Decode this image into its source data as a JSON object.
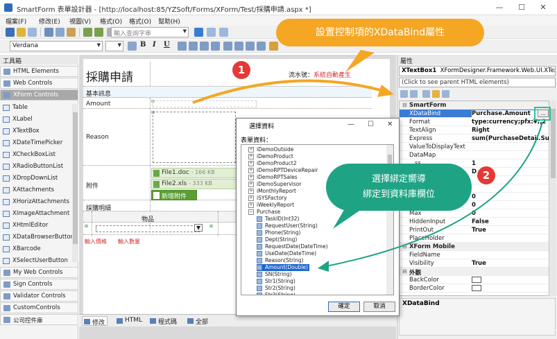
{
  "window": {
    "title": "SmartForm 表單設計器 - [http://localhost:85/YZSoft/Forms/XForm/Test/採購申請.aspx *]",
    "minimize": "—",
    "maximize": "☐",
    "close": "✕"
  },
  "menu": [
    "檔案(F)",
    "修改(E)",
    "視圖(V)",
    "格式(O)",
    "格式(O)",
    "幫助(H)"
  ],
  "toolbar": {
    "search_placeholder": "輸入查詢字串",
    "font_name": "Verdana",
    "bold": "B",
    "italic": "I",
    "underline": "U"
  },
  "toolbox": {
    "header": "工具箱",
    "groups_top": [
      "HTML Elements",
      "Web Controls",
      "XForm Controls"
    ],
    "items": [
      "Table",
      "XLabel",
      "XTextBox",
      "XDateTimePicker",
      "XCheckBoxList",
      "XRadioButtonList",
      "XDropDownList",
      "XAttachments",
      "XHorizAttachments",
      "XImageAttachment",
      "XHtmlEditor",
      "XDataBrowserButton",
      "XBarcode",
      "XSelectUserButton"
    ],
    "groups_bottom": [
      "My Web Controls",
      "Sign Controls",
      "Validator Controls",
      "CustomControls",
      "公司控件庫"
    ]
  },
  "form": {
    "title": "採購申請",
    "serial_label": "流水號：",
    "serial_value": "系統自動產生",
    "section_basic": "基本訊息",
    "amount_label": "Amount",
    "reason_label": "Reason",
    "attach_label": "附件",
    "files": [
      {
        "name": "File1.doc",
        "size": "- 166 KB"
      },
      {
        "name": "File2.xls",
        "size": "- 333 KB"
      }
    ],
    "add_attach": "新增附件",
    "detail_label": "採購明細",
    "col_item": "物品",
    "price_hint": "輸入價格",
    "qty_hint": "輸入數量"
  },
  "design_tabs": [
    "修改",
    "HTML",
    "程式碼",
    "全部"
  ],
  "props": {
    "header": "屬性",
    "object": "XTextBox1",
    "object_type": "XFormDesigner.Framework.Web.UI.XTextB",
    "hint": "(Click to see parent HTML elements)",
    "rows": [
      {
        "type": "cat",
        "name": "SmartForm",
        "value": ""
      },
      {
        "type": "sel",
        "name": "XDataBind",
        "value": "Purchase.Amount"
      },
      {
        "type": "row",
        "name": "Format",
        "value": "type:currency;pfx:¥;,2"
      },
      {
        "type": "row",
        "name": "TextAlign",
        "value": "Right"
      },
      {
        "type": "row",
        "name": "Express",
        "value": "sum(PurchaseDetail.SubTo"
      },
      {
        "type": "row",
        "name": "ValueToDisplayText",
        "value": ""
      },
      {
        "type": "row",
        "name": "DataMap",
        "value": ""
      },
      {
        "type": "row",
        "name": "...ss",
        "value": "1"
      },
      {
        "type": "row",
        "name": "",
        "value": "D"
      },
      {
        "type": "row",
        "name": "",
        "value": ""
      },
      {
        "type": "row",
        "name": "",
        "value": ""
      },
      {
        "type": "row",
        "name": "",
        "value": "0"
      },
      {
        "type": "row",
        "name": "Min",
        "value": "0"
      },
      {
        "type": "row",
        "name": "Max",
        "value": "0"
      },
      {
        "type": "row",
        "name": "HiddenInput",
        "value": "False"
      },
      {
        "type": "row",
        "name": "PrintOut",
        "value": "True"
      },
      {
        "type": "row",
        "name": "PlaceHolder",
        "value": ""
      },
      {
        "type": "cat",
        "name": "XForm Mobile",
        "value": ""
      },
      {
        "type": "row",
        "name": "FieldName",
        "value": ""
      },
      {
        "type": "row",
        "name": "Visibility",
        "value": "True"
      },
      {
        "type": "cat",
        "name": "外觀",
        "value": ""
      },
      {
        "type": "row",
        "name": "BackColor",
        "value": ""
      },
      {
        "type": "row",
        "name": "BorderColor",
        "value": ""
      }
    ],
    "description": "XDataBind"
  },
  "dialog": {
    "title": "選擇資料",
    "label": "表單資料：",
    "tree": [
      {
        "kind": "table",
        "label": "iDemoOutside"
      },
      {
        "kind": "table",
        "label": "iDemoProduct"
      },
      {
        "kind": "table",
        "label": "iDemoProduct2"
      },
      {
        "kind": "table",
        "label": "iDemoRPTDeviceRepair"
      },
      {
        "kind": "table",
        "label": "iDemoRPTSales"
      },
      {
        "kind": "table",
        "label": "iDemoSupervisor"
      },
      {
        "kind": "table",
        "label": "iMonthlyReport"
      },
      {
        "kind": "table",
        "label": "iSYSFactory"
      },
      {
        "kind": "table",
        "label": "iWeeklyReport"
      },
      {
        "kind": "open",
        "label": "Purchase"
      },
      {
        "kind": "field",
        "label": "TaskID(Int32)"
      },
      {
        "kind": "field",
        "label": "RequestUser(String)"
      },
      {
        "kind": "field",
        "label": "Phone(String)"
      },
      {
        "kind": "field",
        "label": "Dept(String)"
      },
      {
        "kind": "field",
        "label": "RequestDate(DateTime)"
      },
      {
        "kind": "field",
        "label": "UseDate(DateTime)"
      },
      {
        "kind": "field",
        "label": "Reason(String)"
      },
      {
        "kind": "hl",
        "label": "Amount(Double)"
      },
      {
        "kind": "field",
        "label": "SN(String)"
      },
      {
        "kind": "field",
        "label": "Str1(String)"
      },
      {
        "kind": "field",
        "label": "Str2(String)"
      },
      {
        "kind": "field",
        "label": "Str3(String)"
      }
    ],
    "ok": "確定",
    "cancel": "取消"
  },
  "callouts": {
    "top": "設置控制項的XDataBind屬性",
    "bottom_line1": "選擇綁定嚮導",
    "bottom_line2": "綁定到資料庫欄位",
    "badge1": "1",
    "badge2": "2"
  },
  "colors": {
    "callout_orange": "#f5a623",
    "callout_green": "#1fa385",
    "badge_red": "#e53935",
    "selection_blue": "#3a7bd5"
  }
}
